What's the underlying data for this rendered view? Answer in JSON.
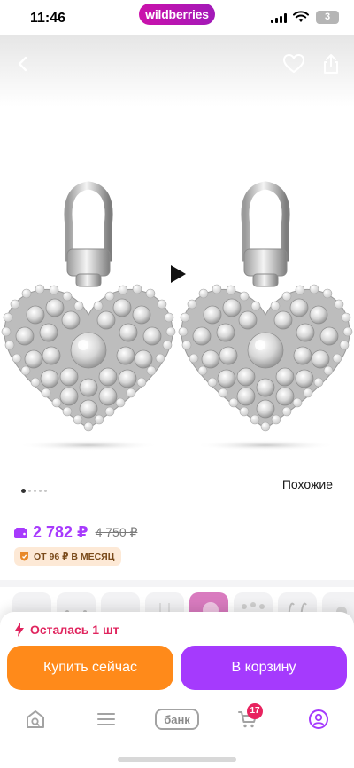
{
  "status_bar": {
    "time": "11:46",
    "brand": "wildberries",
    "battery": "3"
  },
  "gallery": {
    "icons": [
      "back-arrow-icon",
      "heart-icon",
      "share-icon",
      "play-icon"
    ],
    "pagination_count": 5,
    "active_index": 0,
    "similar_label": "Похожие"
  },
  "price": {
    "current": "2 782 ₽",
    "old": "4 750 ₽",
    "current_color": "#a73afd",
    "installment": "ОТ 96 ₽ В МЕСЯЦ"
  },
  "thumbnails": {
    "count": 8
  },
  "purchase": {
    "stock_text": "Осталась 1 шт",
    "buy_now_label": "Купить сейчас",
    "buy_now_color": "#ff8a1a",
    "cart_label": "В корзину",
    "cart_color": "#a53afd"
  },
  "tabbar": {
    "items": [
      "home-search-icon",
      "menu-icon",
      "bank-tab",
      "cart-icon",
      "profile-icon"
    ],
    "bank_label": "банк",
    "cart_count": "17",
    "active_color": "#a53afd"
  }
}
